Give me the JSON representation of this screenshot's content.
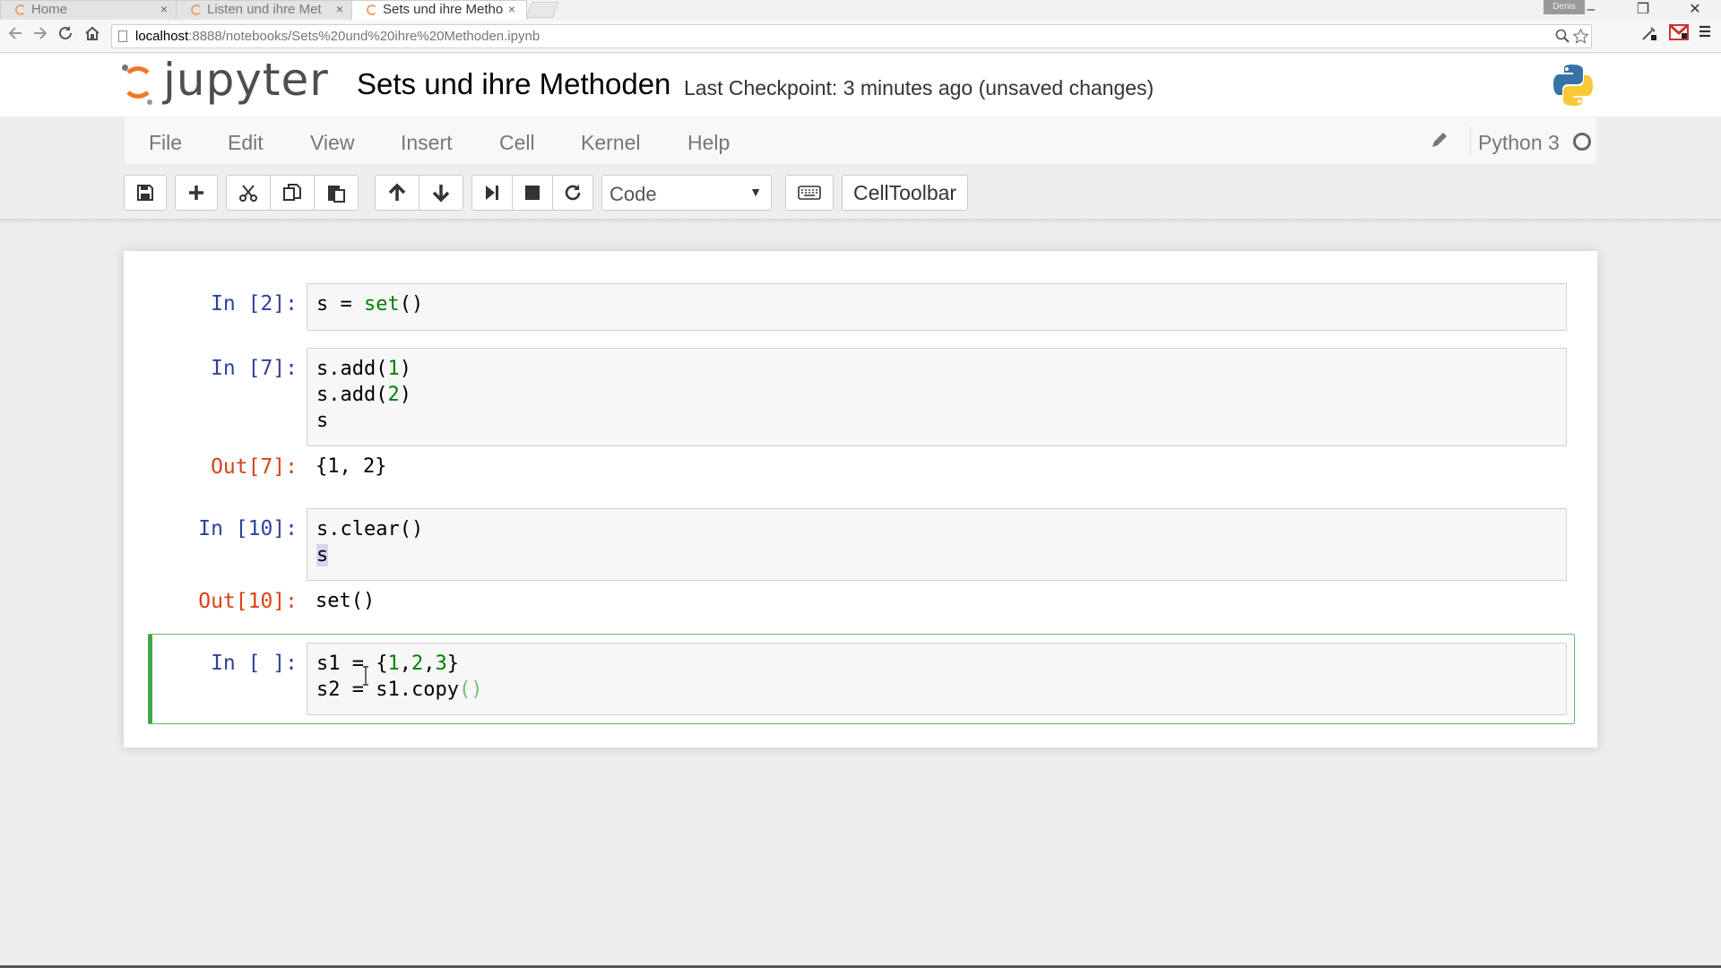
{
  "browser": {
    "tabs": [
      {
        "label": "Home",
        "active": false
      },
      {
        "label": "Listen und ihre Met",
        "active": false
      },
      {
        "label": "Sets und ihre Metho",
        "active": true
      }
    ],
    "tab_close": "×",
    "user_label": "Denis",
    "window_controls": {
      "minimize": "–",
      "restore": "❐",
      "close": "✕"
    },
    "url_host": "localhost",
    "url_path": ":8888/notebooks/Sets%20und%20ihre%20Methoden.ipynb",
    "icons": [
      "back-icon",
      "forward-icon",
      "reload-icon",
      "home-icon",
      "zoom-icon",
      "star-icon",
      "extension-icon",
      "gmail-icon",
      "menu-icon"
    ]
  },
  "header": {
    "logo_text": "jupyter",
    "notebook_title": "Sets und ihre Methoden",
    "checkpoint": "Last Checkpoint: 3 minutes ago (unsaved changes)"
  },
  "menubar": {
    "items": [
      "File",
      "Edit",
      "View",
      "Insert",
      "Cell",
      "Kernel",
      "Help"
    ],
    "kernel_name": "Python 3"
  },
  "toolbar": {
    "cell_type": "Code",
    "celltoolbar_label": "CellToolbar",
    "icons": [
      "save-icon",
      "plus-icon",
      "cut-icon",
      "copy-icon",
      "paste-icon",
      "arrow-up-icon",
      "arrow-down-icon",
      "step-forward-icon",
      "stop-icon",
      "restart-icon",
      "keyboard-icon"
    ]
  },
  "cells": [
    {
      "prompt": "In [2]:",
      "lines": [
        "s = set()"
      ]
    },
    {
      "prompt": "In [7]:",
      "lines": [
        "s.add(1)",
        "s.add(2)",
        "s"
      ],
      "out_prompt": "Out[7]:",
      "output": "{1, 2}"
    },
    {
      "prompt": "In [10]:",
      "lines": [
        "s.clear()",
        "s"
      ],
      "out_prompt": "Out[10]:",
      "output": "set()"
    },
    {
      "prompt": "In [ ]:",
      "lines": [
        "s1 = {1,2,3}",
        "s2 = s1.copy()"
      ],
      "selected": true
    }
  ],
  "colors": {
    "in_prompt": "#303f9f",
    "out_prompt": "#d84315",
    "selected_cell_border": "#42a548",
    "jupyter_orange": "#f37726"
  }
}
